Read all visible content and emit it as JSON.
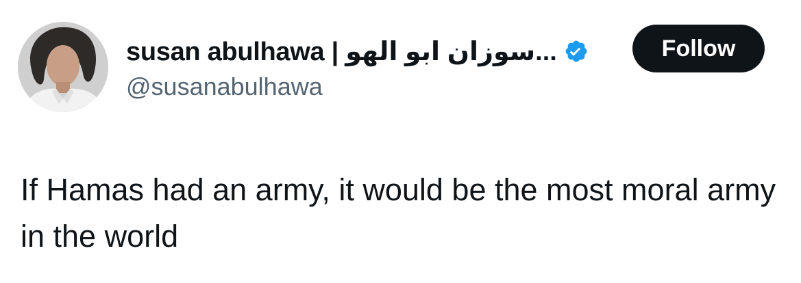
{
  "author": {
    "display_name": "susan abulhawa | سوزان ابو الهو...",
    "handle": "@susanabulhawa",
    "verified_icon": "verified-badge-icon",
    "avatar": "profile-photo"
  },
  "follow_button": {
    "label": "Follow"
  },
  "tweet": {
    "text": "If Hamas had an army, it would be the most moral army in the world"
  },
  "colors": {
    "text": "#0f1419",
    "secondary_text": "#536471",
    "verified_blue": "#1d9bf0",
    "follow_bg": "#0f1419",
    "follow_text": "#ffffff"
  }
}
